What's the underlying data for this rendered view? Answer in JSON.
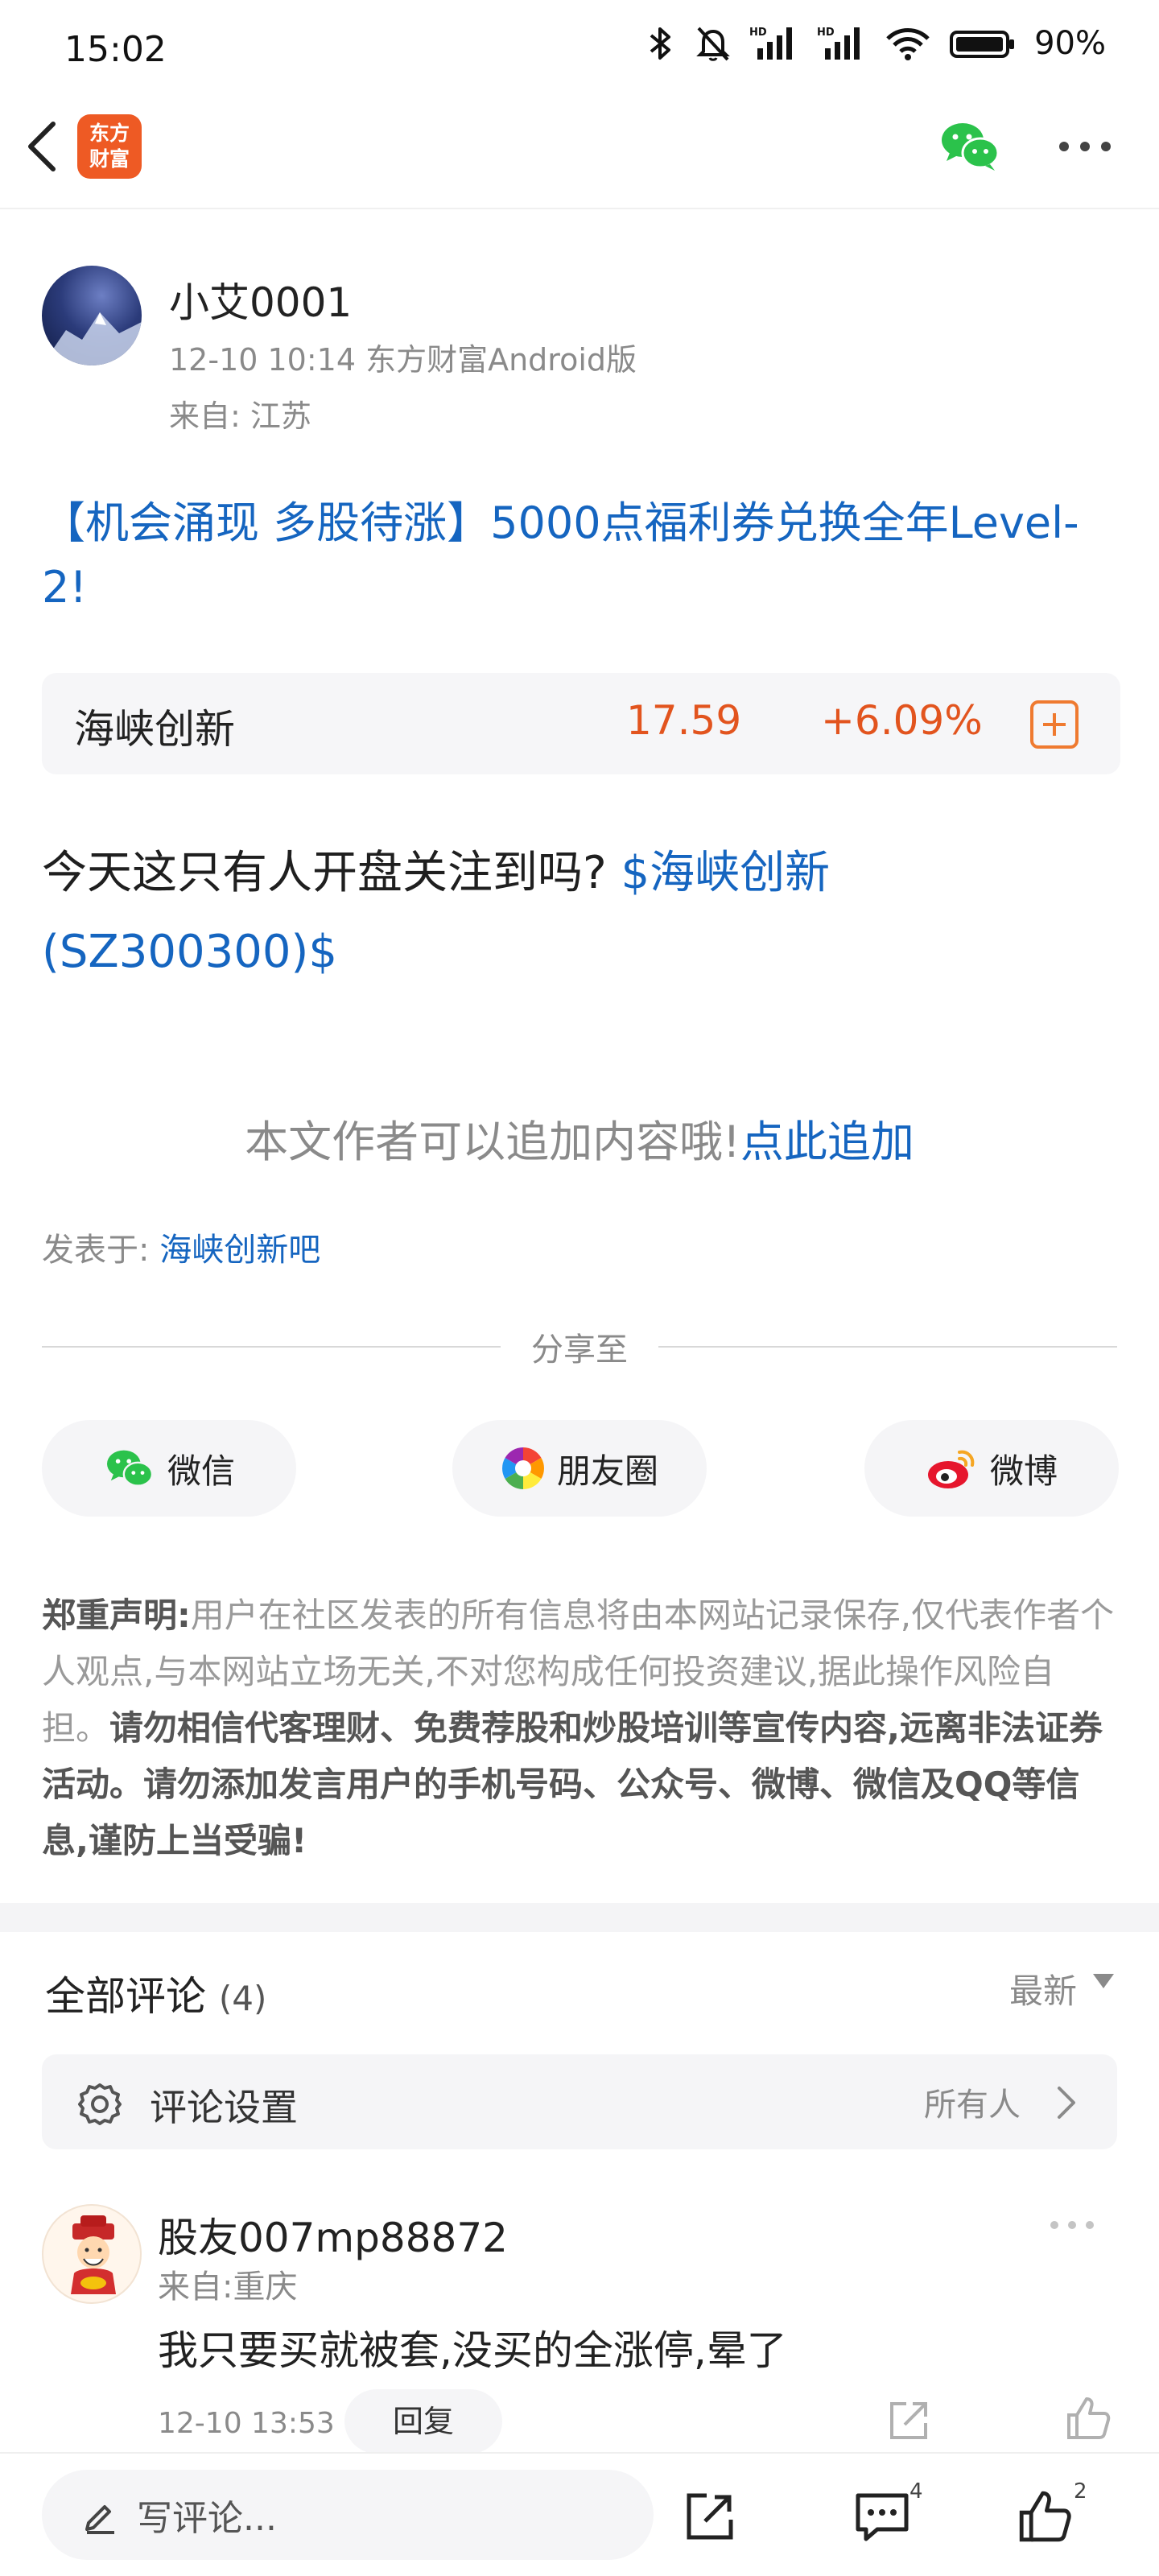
{
  "status_bar": {
    "time": "15:02",
    "battery_percent": "90%",
    "icons": [
      "bluetooth-icon",
      "bell-off-icon",
      "hd-signal-icon",
      "hd-signal-icon",
      "wifi-icon",
      "battery-icon"
    ]
  },
  "header": {
    "logo_line1": "东方",
    "logo_line2": "财富",
    "icons": [
      "back-arrow-icon",
      "wechat-icon",
      "more-dots-icon"
    ],
    "brand_color": "#ee5a24"
  },
  "author": {
    "name": "小艾0001",
    "meta": "12-10 10:14 东方财富Android版",
    "location": "来自: 江苏"
  },
  "post": {
    "title": "【机会涌现 多股待涨】5000点福利券兑换全年Level-2!",
    "body_text": "今天这只有人开盘关注到吗?",
    "stock_tag_line1": "$海峡创新",
    "stock_tag_line2": "(SZ300300)$"
  },
  "stock_card": {
    "name": "海峡创新",
    "price": "17.59",
    "change": "+6.09%",
    "up_color": "#e2541e"
  },
  "append": {
    "text": "本文作者可以追加内容哦!",
    "link": "点此追加"
  },
  "posted_in": {
    "label": "发表于:",
    "link": "海峡创新吧"
  },
  "share": {
    "title": "分享至",
    "buttons": [
      {
        "label": "微信",
        "icon": "wechat-icon"
      },
      {
        "label": "朋友圈",
        "icon": "moments-icon"
      },
      {
        "label": "微博",
        "icon": "weibo-icon"
      }
    ]
  },
  "disclaimer": {
    "label": "郑重声明:",
    "text": "用户在社区发表的所有信息将由本网站记录保存,仅代表作者个人观点,与本网站立场无关,不对您构成任何投资建议,据此操作风险自担。",
    "strong_text": "请勿相信代客理财、免费荐股和炒股培训等宣传内容,远离非法证券活动。请勿添加发言用户的手机号码、公众号、微博、微信及QQ等信息,谨防上当受骗!"
  },
  "comments": {
    "title": "全部评论",
    "count": "(4)",
    "sort": "最新",
    "settings_label": "评论设置",
    "settings_value": "所有人",
    "items": [
      {
        "user": "股友007mp88872",
        "location": "来自:重庆",
        "text": "我只要买就被套,没买的全涨停,晕了",
        "time": "12-10 13:53",
        "reply_label": "回复"
      }
    ]
  },
  "bottom_bar": {
    "input_placeholder": "写评论...",
    "comment_count": "4",
    "like_count": "2"
  }
}
